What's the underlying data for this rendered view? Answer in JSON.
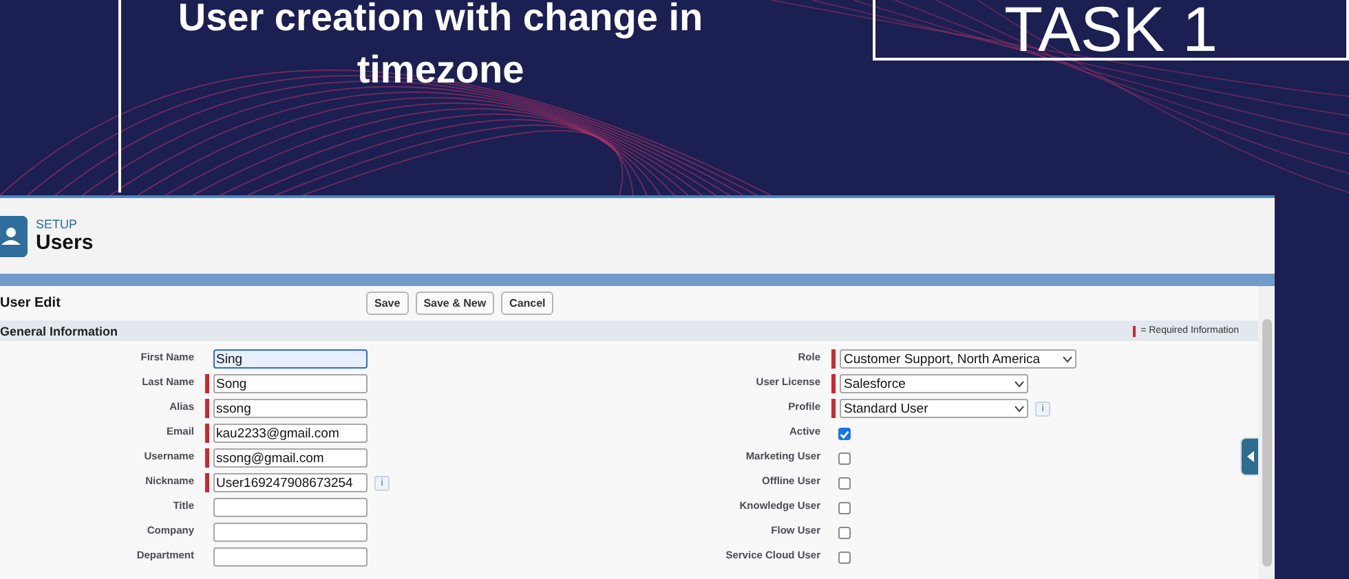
{
  "slide": {
    "title": "User creation with change in timezone",
    "task_label": "TASK 1"
  },
  "app": {
    "breadcrumb": "SETUP",
    "page_title": "Users",
    "form_title": "User Edit",
    "buttons": [
      "Save",
      "Save & New",
      "Cancel"
    ],
    "section": {
      "title": "General Information",
      "legend": "= Required Information"
    },
    "left_fields": [
      {
        "label": "First Name",
        "value": "Sing",
        "required": false,
        "focused": true
      },
      {
        "label": "Last Name",
        "value": "Song",
        "required": true,
        "focused": false
      },
      {
        "label": "Alias",
        "value": "ssong",
        "required": true,
        "focused": false
      },
      {
        "label": "Email",
        "value": "kau2233@gmail.com",
        "required": true,
        "focused": false
      },
      {
        "label": "Username",
        "value": "ssong@gmail.com",
        "required": true,
        "focused": false
      },
      {
        "label": "Nickname",
        "value": "User169247908673254",
        "required": true,
        "focused": false,
        "info": "i"
      },
      {
        "label": "Title",
        "required": false,
        "focused": false
      },
      {
        "label": "Company",
        "required": false,
        "focused": false
      },
      {
        "label": "Department",
        "required": false,
        "focused": false
      }
    ],
    "right_fields": [
      {
        "kind": "select",
        "label": "Role",
        "value": "Customer Support, North America",
        "required": true,
        "wide": true
      },
      {
        "kind": "select",
        "label": "User License",
        "value": "Salesforce",
        "required": true,
        "wide": false
      },
      {
        "kind": "select",
        "label": "Profile",
        "value": "Standard User",
        "required": true,
        "info": "i",
        "wide": false
      },
      {
        "kind": "checkbox",
        "label": "Active",
        "checked": true
      },
      {
        "kind": "checkbox",
        "label": "Marketing User",
        "checked": false
      },
      {
        "kind": "checkbox",
        "label": "Offline User",
        "checked": false
      },
      {
        "kind": "checkbox",
        "label": "Knowledge User",
        "checked": false
      },
      {
        "kind": "checkbox",
        "label": "Flow User",
        "checked": false
      },
      {
        "kind": "checkbox",
        "label": "Service Cloud User",
        "checked": false
      }
    ]
  }
}
